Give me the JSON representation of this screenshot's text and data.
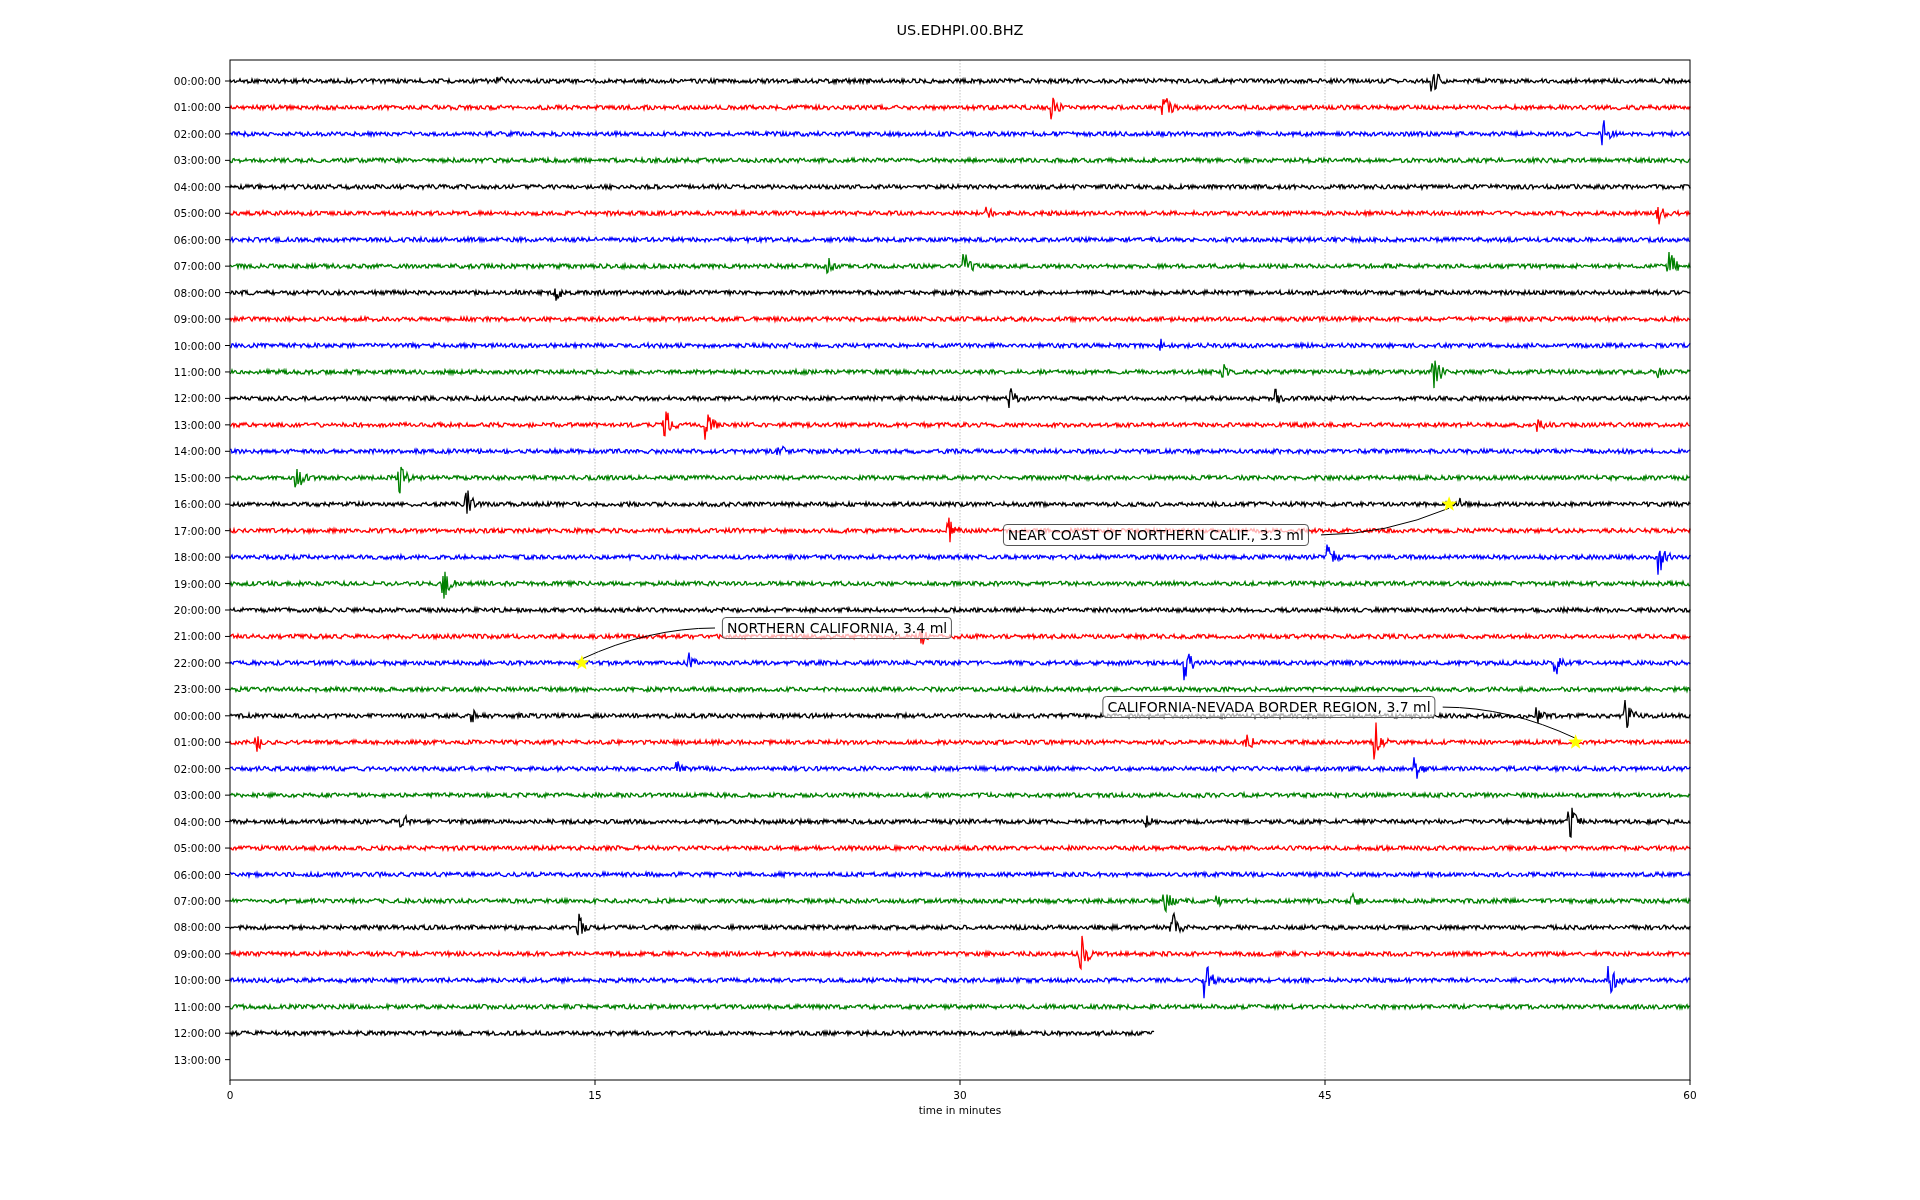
{
  "plot": {
    "title": "US.EDHPI.00.BHZ",
    "xlabel": "time in minutes",
    "xticks": [
      "0",
      "15",
      "30",
      "45",
      "60"
    ],
    "rows": [
      {
        "label": "00:00:00",
        "color": "#000000",
        "level": 1
      },
      {
        "label": "01:00:00",
        "color": "#ff0000",
        "level": 1
      },
      {
        "label": "02:00:00",
        "color": "#0000ff",
        "level": 1
      },
      {
        "label": "03:00:00",
        "color": "#008000",
        "level": 1
      },
      {
        "label": "04:00:00",
        "color": "#000000",
        "level": 1
      },
      {
        "label": "05:00:00",
        "color": "#ff0000",
        "level": 1
      },
      {
        "label": "06:00:00",
        "color": "#0000ff",
        "level": 1
      },
      {
        "label": "07:00:00",
        "color": "#008000",
        "level": 1
      },
      {
        "label": "08:00:00",
        "color": "#000000",
        "level": 1
      },
      {
        "label": "09:00:00",
        "color": "#ff0000",
        "level": 1
      },
      {
        "label": "10:00:00",
        "color": "#0000ff",
        "level": 1
      },
      {
        "label": "11:00:00",
        "color": "#008000",
        "level": 1
      },
      {
        "label": "12:00:00",
        "color": "#000000",
        "level": 1
      },
      {
        "label": "13:00:00",
        "color": "#ff0000",
        "level": 1
      },
      {
        "label": "14:00:00",
        "color": "#0000ff",
        "level": 1
      },
      {
        "label": "15:00:00",
        "color": "#008000",
        "level": 1
      },
      {
        "label": "16:00:00",
        "color": "#000000",
        "level": 1
      },
      {
        "label": "17:00:00",
        "color": "#ff0000",
        "level": 1
      },
      {
        "label": "18:00:00",
        "color": "#0000ff",
        "level": 1
      },
      {
        "label": "19:00:00",
        "color": "#008000",
        "level": 1
      },
      {
        "label": "20:00:00",
        "color": "#000000",
        "level": 1
      },
      {
        "label": "21:00:00",
        "color": "#ff0000",
        "level": 1
      },
      {
        "label": "22:00:00",
        "color": "#0000ff",
        "level": 1
      },
      {
        "label": "23:00:00",
        "color": "#008000",
        "level": 1
      },
      {
        "label": "00:00:00",
        "color": "#000000",
        "level": 1
      },
      {
        "label": "01:00:00",
        "color": "#ff0000",
        "level": 1
      },
      {
        "label": "02:00:00",
        "color": "#0000ff",
        "level": 1
      },
      {
        "label": "03:00:00",
        "color": "#008000",
        "level": 1
      },
      {
        "label": "04:00:00",
        "color": "#000000",
        "level": 1
      },
      {
        "label": "05:00:00",
        "color": "#ff0000",
        "level": 1
      },
      {
        "label": "06:00:00",
        "color": "#0000ff",
        "level": 1
      },
      {
        "label": "07:00:00",
        "color": "#008000",
        "level": 1
      },
      {
        "label": "08:00:00",
        "color": "#000000",
        "level": 1
      },
      {
        "label": "09:00:00",
        "color": "#ff0000",
        "level": 1
      },
      {
        "label": "10:00:00",
        "color": "#0000ff",
        "level": 1
      },
      {
        "label": "11:00:00",
        "color": "#008000",
        "level": 1
      },
      {
        "label": "12:00:00",
        "color": "#000000",
        "level": 0.633
      },
      {
        "label": "13:00:00"
      }
    ],
    "events": [
      {
        "label": "NEAR COAST OF NORTHERN CALIF., 3.3 ml"
      },
      {
        "label": "NORTHERN CALIFORNIA, 3.4 ml"
      },
      {
        "label": "CALIFORNIA-NEVADA BORDER REGION, 3.7 ml"
      }
    ]
  }
}
